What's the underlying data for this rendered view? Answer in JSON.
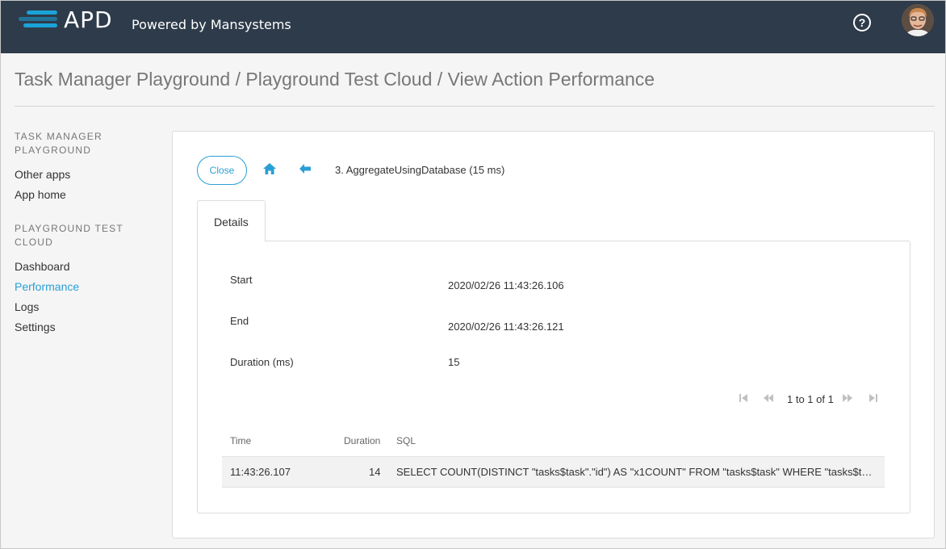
{
  "header": {
    "logo_text": "APD",
    "subtitle": "Powered by Mansystems",
    "help_label": "?",
    "colors": {
      "bar": "#2e3b4a",
      "accent": "#1aa3d9"
    }
  },
  "page_title": "Task Manager Playground / Playground Test Cloud / View Action Performance",
  "sidebar": {
    "sections": [
      {
        "heading": "TASK MANAGER PLAYGROUND",
        "items": [
          {
            "label": "Other apps"
          },
          {
            "label": "App home"
          }
        ]
      },
      {
        "heading": "PLAYGROUND TEST CLOUD",
        "items": [
          {
            "label": "Dashboard"
          },
          {
            "label": "Performance"
          },
          {
            "label": "Logs"
          },
          {
            "label": "Settings"
          }
        ]
      }
    ],
    "active_item": "Performance"
  },
  "toolbar": {
    "close_label": "Close",
    "home_icon": "home-icon",
    "back_icon": "back-arrow-icon",
    "action_crumb": "3. AggregateUsingDatabase (15 ms)"
  },
  "tabs": [
    {
      "label": "Details"
    }
  ],
  "details": {
    "start_label": "Start",
    "start_value": "2020/02/26 11:43:26.106",
    "end_label": "End",
    "end_value": "2020/02/26 11:43:26.121",
    "duration_label": "Duration (ms)",
    "duration_value": "15"
  },
  "pager": {
    "text": "1 to 1 of 1"
  },
  "table": {
    "columns": [
      "Time",
      "Duration",
      "SQL"
    ],
    "rows": [
      {
        "time": "11:43:26.107",
        "duration": "14",
        "sql": "SELECT COUNT(DISTINCT \"tasks$task\".\"id\") AS \"x1COUNT\" FROM \"tasks$task\" WHERE \"tasks$task\".\"status\" = ?"
      }
    ]
  },
  "accent_color": "#2a9fd6"
}
